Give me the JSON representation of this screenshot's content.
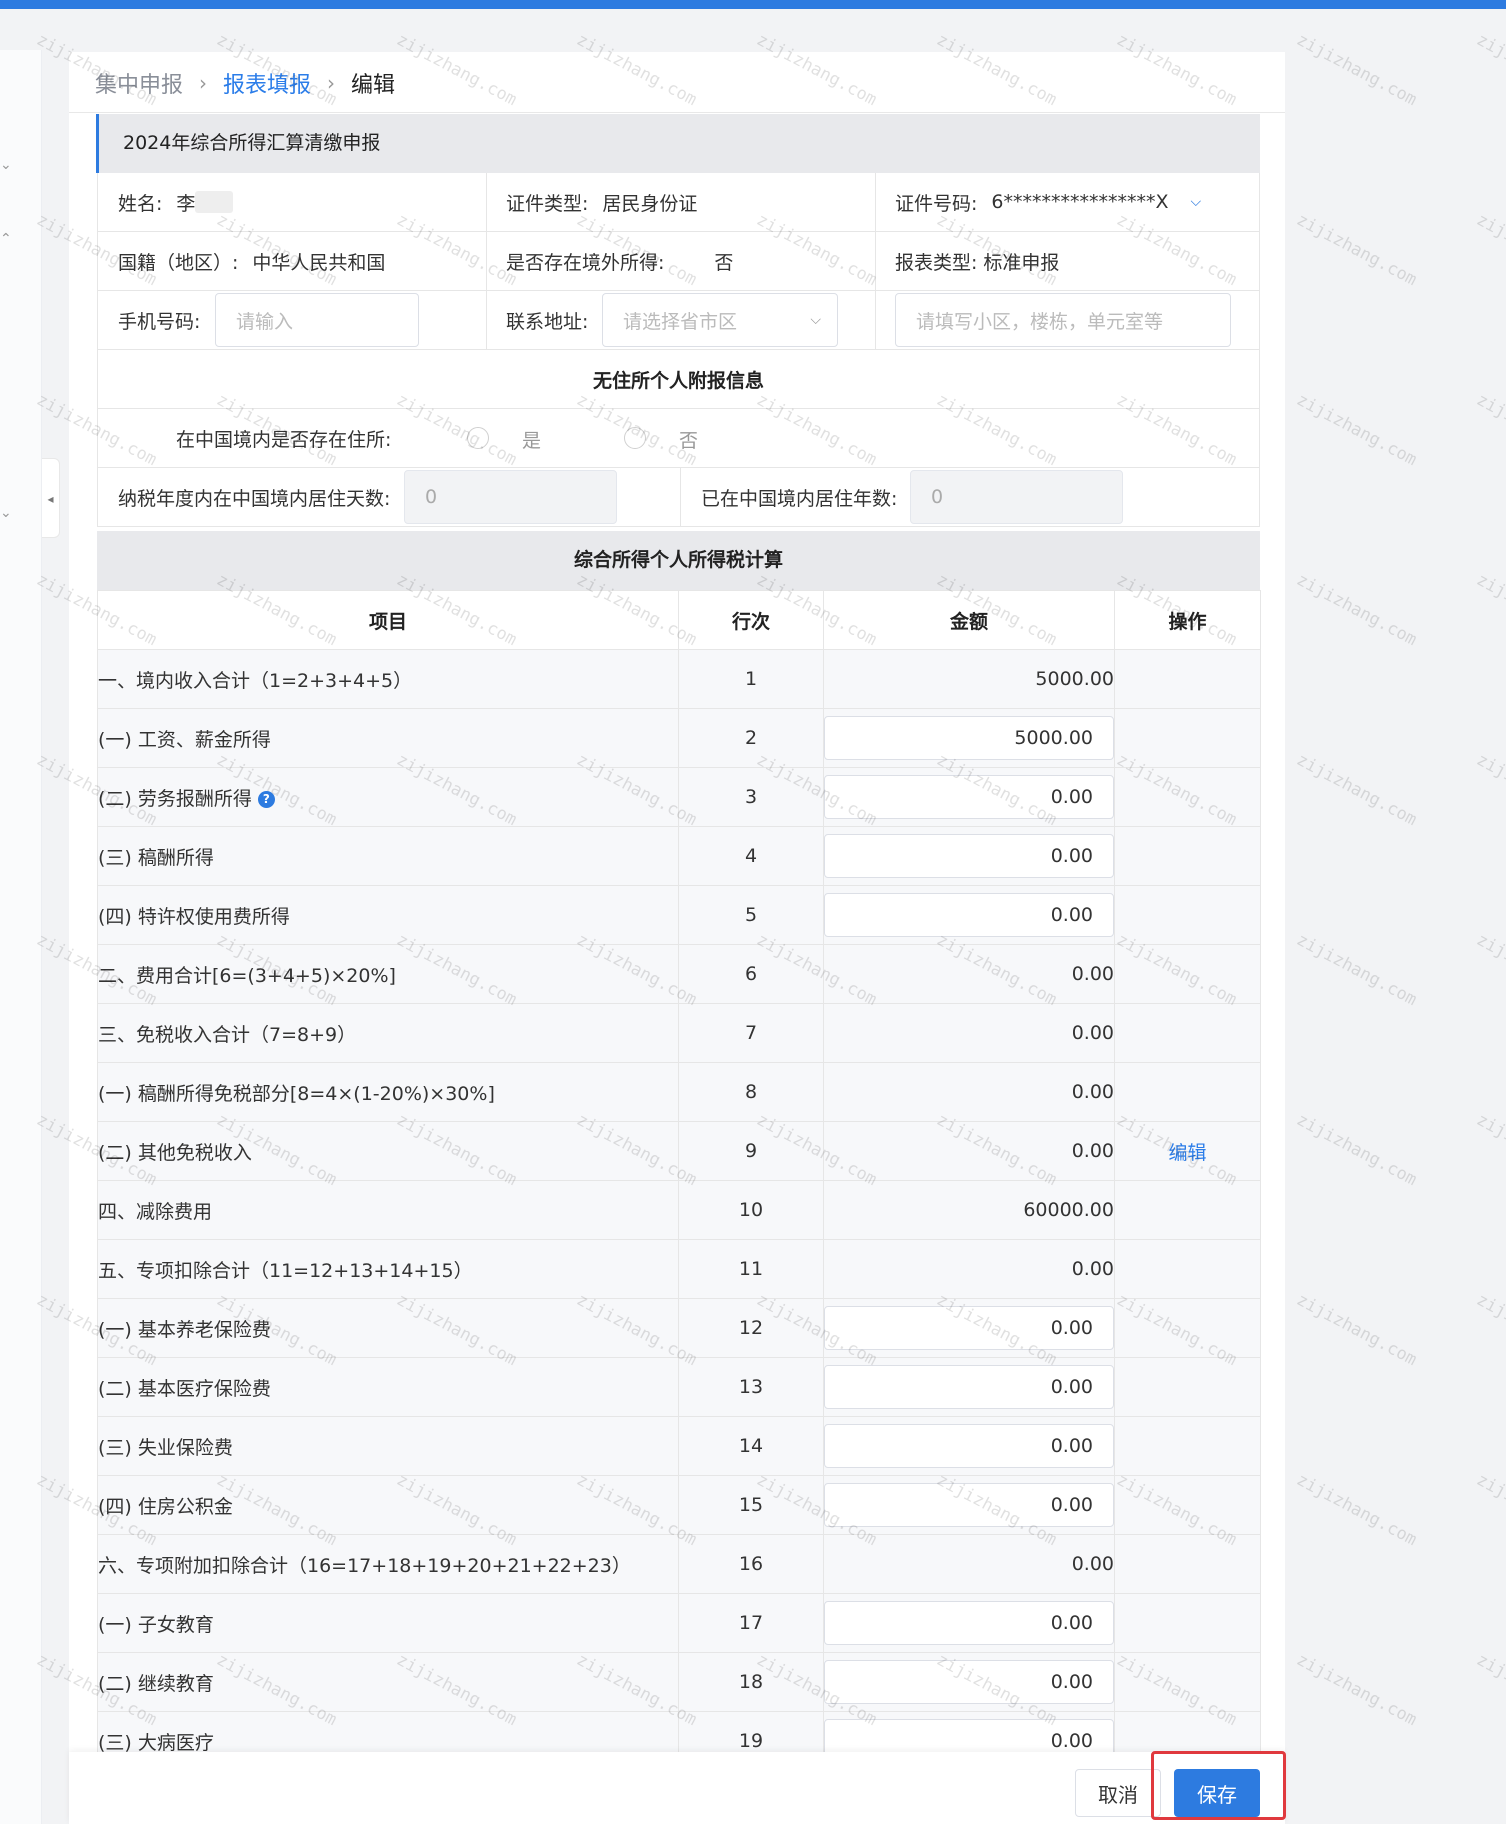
{
  "breadcrumb": {
    "item1": "集中申报",
    "item2": "报表填报",
    "item3": "编辑",
    "sep": "›"
  },
  "form_title": "2024年综合所得汇算清缴申报",
  "info": {
    "name_label": "姓名:",
    "name_value": "李",
    "id_type_label": "证件类型:",
    "id_type_value": "居民身份证",
    "id_no_label": "证件号码:",
    "id_no_value": "6****************X",
    "nationality_label": "国籍（地区）:",
    "nationality_value": "中华人民共和国",
    "overseas_label": "是否存在境外所得:",
    "overseas_value": "否",
    "report_type_label": "报表类型:",
    "report_type_value": "标准申报",
    "phone_label": "手机号码:",
    "phone_placeholder": "请输入",
    "address_label": "联系地址:",
    "address_placeholder": "请选择省市区",
    "address_detail_placeholder": "请填写小区，楼栋，单元室等"
  },
  "nonresident": {
    "title": "无住所个人附报信息",
    "residence_question": "在中国境内是否存在住所:",
    "option_yes": "是",
    "option_no": "否",
    "days_label": "纳税年度内在中国境内居住天数:",
    "days_value": "0",
    "years_label": "已在中国境内居住年数:",
    "years_value": "0"
  },
  "calc": {
    "title": "综合所得个人所得税计算",
    "headers": {
      "item": "项目",
      "row": "行次",
      "amount": "金额",
      "action": "操作"
    },
    "edit_label": "编辑",
    "rows": [
      {
        "item": "一、境内收入合计（1=2+3+4+5）",
        "row": "1",
        "amount": "5000.00"
      },
      {
        "item": "(一) 工资、薪金所得",
        "row": "2",
        "amount": "5000.00"
      },
      {
        "item": "(二) 劳务报酬所得",
        "row": "3",
        "amount": "0.00"
      },
      {
        "item": "(三) 稿酬所得",
        "row": "4",
        "amount": "0.00"
      },
      {
        "item": "(四) 特许权使用费所得",
        "row": "5",
        "amount": "0.00"
      },
      {
        "item": "二、费用合计[6=(3+4+5)×20%]",
        "row": "6",
        "amount": "0.00"
      },
      {
        "item": "三、免税收入合计（7=8+9）",
        "row": "7",
        "amount": "0.00"
      },
      {
        "item": "(一) 稿酬所得免税部分[8=4×(1-20%)×30%]",
        "row": "8",
        "amount": "0.00"
      },
      {
        "item": "(二) 其他免税收入",
        "row": "9",
        "amount": "0.00"
      },
      {
        "item": "四、减除费用",
        "row": "10",
        "amount": "60000.00"
      },
      {
        "item": "五、专项扣除合计（11=12+13+14+15）",
        "row": "11",
        "amount": "0.00"
      },
      {
        "item": "(一) 基本养老保险费",
        "row": "12",
        "amount": "0.00"
      },
      {
        "item": "(二) 基本医疗保险费",
        "row": "13",
        "amount": "0.00"
      },
      {
        "item": "(三) 失业保险费",
        "row": "14",
        "amount": "0.00"
      },
      {
        "item": "(四) 住房公积金",
        "row": "15",
        "amount": "0.00"
      },
      {
        "item": "六、专项附加扣除合计（16=17+18+19+20+21+22+23）",
        "row": "16",
        "amount": "0.00"
      },
      {
        "item": "(一) 子女教育",
        "row": "17",
        "amount": "0.00"
      },
      {
        "item": "(二) 继续教育",
        "row": "18",
        "amount": "0.00"
      },
      {
        "item": "(三) 大病医疗",
        "row": "19",
        "amount": "0.00"
      }
    ]
  },
  "footer": {
    "cancel_label": "取消",
    "save_label": "保存"
  },
  "watermark_text": "zijizhang.com",
  "icons": {
    "help": "?",
    "chevron_down": "⌵",
    "collapse": "◂"
  },
  "colors": {
    "accent": "#2d7be0",
    "highlight": "#e0393e"
  }
}
